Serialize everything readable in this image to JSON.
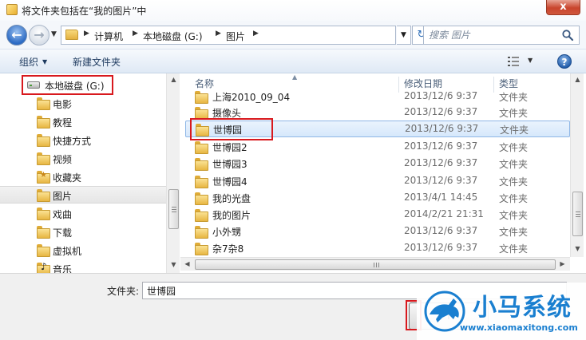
{
  "window": {
    "title": "将文件夹包括在“我的图片”中",
    "close_glyph": "x"
  },
  "address": {
    "breadcrumbs": [
      "计算机",
      "本地磁盘 (G:)",
      "图片"
    ],
    "search_placeholder": "搜索 图片"
  },
  "toolbar": {
    "organize_label": "组织",
    "new_folder_label": "新建文件夹"
  },
  "nav": {
    "items": [
      {
        "label": "本地磁盘 (G:)",
        "icon": "drive-icon"
      },
      {
        "label": "电影",
        "icon": "folder-icon"
      },
      {
        "label": "教程",
        "icon": "folder-icon"
      },
      {
        "label": "快捷方式",
        "icon": "folder-icon"
      },
      {
        "label": "视频",
        "icon": "folder-icon"
      },
      {
        "label": "收藏夹",
        "icon": "favorites-folder-icon"
      },
      {
        "label": "图片",
        "icon": "folder-icon",
        "selected": true
      },
      {
        "label": "戏曲",
        "icon": "folder-icon"
      },
      {
        "label": "下载",
        "icon": "folder-icon"
      },
      {
        "label": "虚拟机",
        "icon": "folder-icon"
      },
      {
        "label": "音乐",
        "icon": "music-folder-icon"
      }
    ]
  },
  "files": {
    "columns": {
      "name": "名称",
      "date": "修改日期",
      "type": "类型"
    },
    "rows": [
      {
        "name": "上海2010_09_04",
        "date": "2013/12/6 9:37",
        "type": "文件夹"
      },
      {
        "name": "摄像头",
        "date": "2013/12/6 9:37",
        "type": "文件夹"
      },
      {
        "name": "世博园",
        "date": "2013/12/6 9:37",
        "type": "文件夹",
        "selected": true
      },
      {
        "name": "世博园2",
        "date": "2013/12/6 9:37",
        "type": "文件夹"
      },
      {
        "name": "世博园3",
        "date": "2013/12/6 9:37",
        "type": "文件夹"
      },
      {
        "name": "世博园4",
        "date": "2013/12/6 9:37",
        "type": "文件夹"
      },
      {
        "name": "我的光盘",
        "date": "2013/4/1 14:45",
        "type": "文件夹"
      },
      {
        "name": "我的图片",
        "date": "2014/2/21 21:31",
        "type": "文件夹"
      },
      {
        "name": "小外甥",
        "date": "2013/12/6 9:37",
        "type": "文件夹"
      },
      {
        "name": "杂7杂8",
        "date": "2013/12/6 9:37",
        "type": "文件夹"
      }
    ]
  },
  "bottom": {
    "folder_label": "文件夹:",
    "folder_value": "世博园",
    "ok_label": "I"
  },
  "watermark": {
    "title": "小马系统",
    "url": "www.xiaomaxitong.com"
  },
  "colors": {
    "highlight": "#d8191e",
    "selection": "#d6e8fb",
    "brand": "#1a7fd0"
  }
}
